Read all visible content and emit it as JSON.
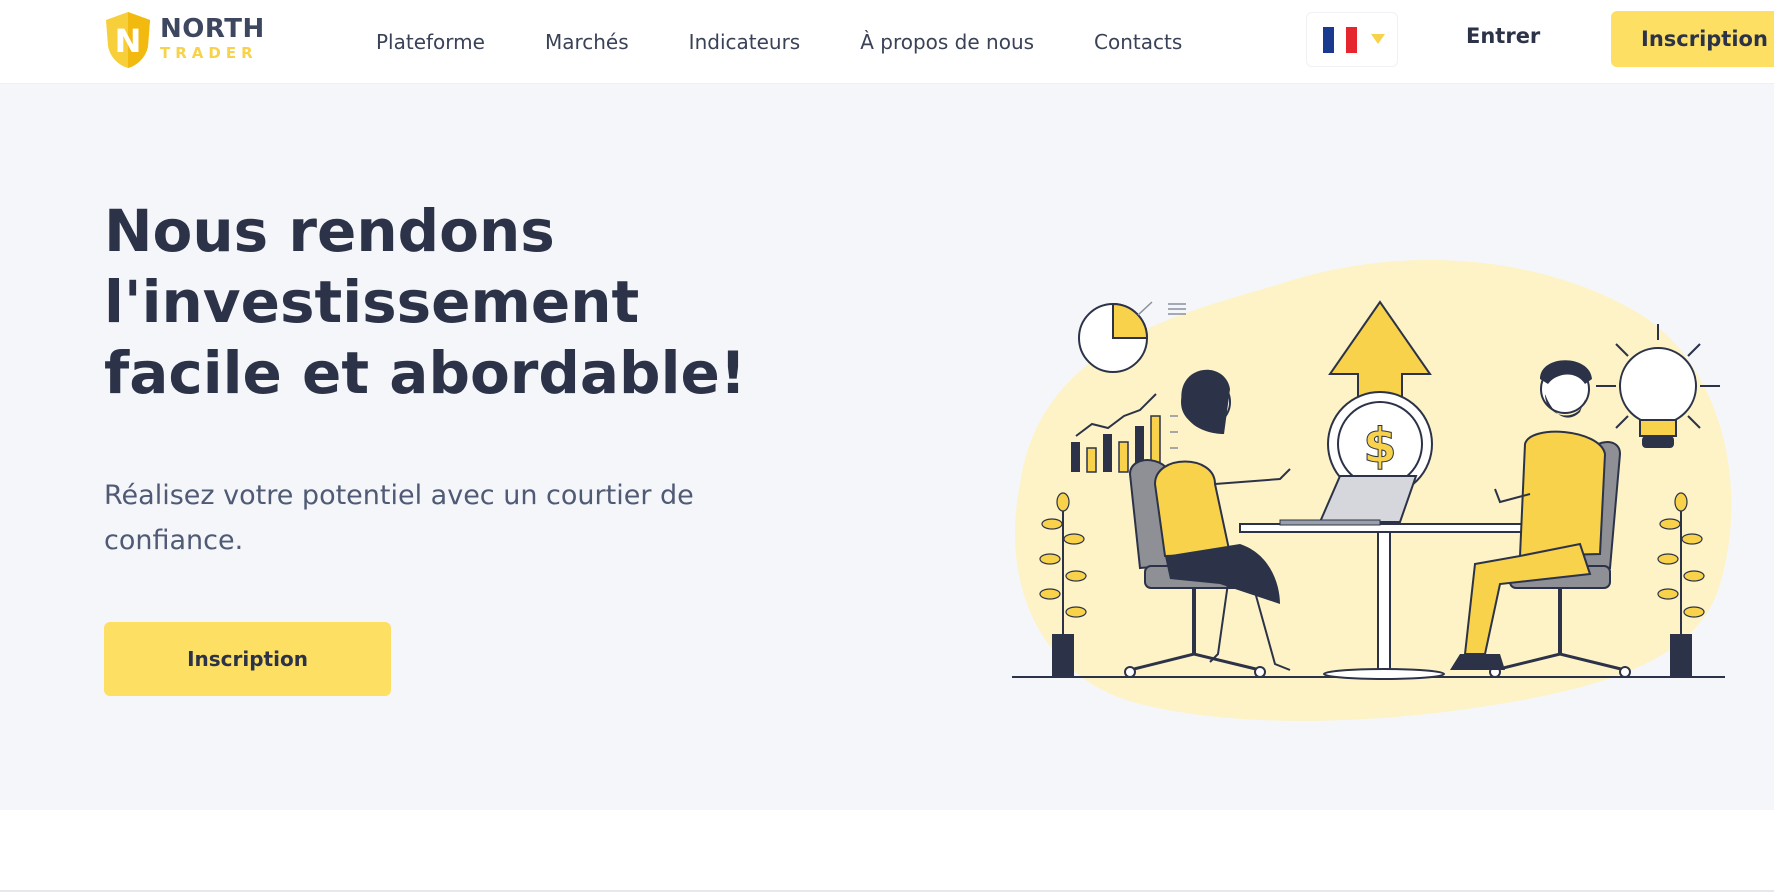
{
  "header": {
    "logo": {
      "line1": "NORTH",
      "line2": "TRADER",
      "mark": "N"
    },
    "nav": [
      {
        "label": "Plateforme"
      },
      {
        "label": "Marchés"
      },
      {
        "label": "Indicateurs"
      },
      {
        "label": "À propos de nous"
      },
      {
        "label": "Contacts"
      }
    ],
    "language": {
      "flag_icon": "france-flag-icon",
      "chevron_icon": "chevron-down-icon"
    },
    "login_label": "Entrer",
    "signup_label": "Inscription"
  },
  "hero": {
    "title_lines": [
      "Nous rendons",
      "l'investissement",
      "facile et abordable!"
    ],
    "subtitle": "Réalisez votre potentiel avec un courtier de confiance.",
    "cta_label": "Inscription",
    "illustration": {
      "name": "business-meeting-illustration",
      "dollar_symbol": "$"
    }
  },
  "colors": {
    "accent": "#fde063",
    "text_dark": "#2c3348",
    "text_muted": "#4f5a74",
    "hero_bg": "#f5f6fa",
    "flag_blue": "#1a3a8f",
    "flag_white": "#ffffff",
    "flag_red": "#e5262f"
  }
}
